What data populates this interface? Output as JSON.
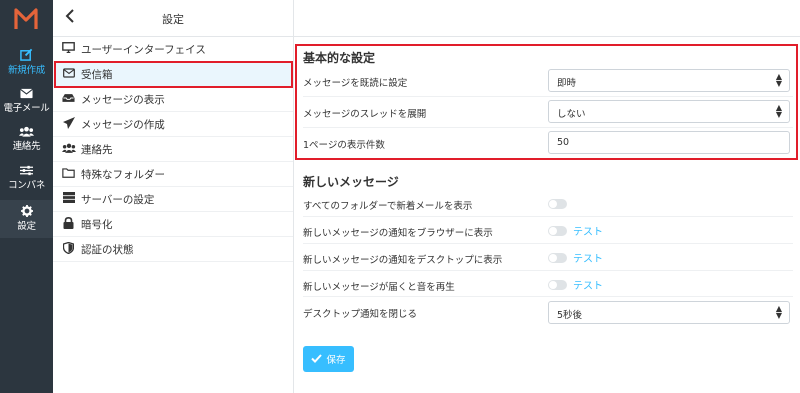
{
  "rail": {
    "compose_label": "新規作成",
    "mail_label": "電子メール",
    "contacts_label": "連絡先",
    "control_panel_label": "コンパネ",
    "settings_label": "設定",
    "accent_color": "#37beff",
    "bg_color": "#2c363f"
  },
  "list": {
    "title": "設定",
    "items": [
      {
        "label": "ユーザーインターフェイス",
        "icon": "monitor-icon"
      },
      {
        "label": "受信箱",
        "icon": "envelope-icon"
      },
      {
        "label": "メッセージの表示",
        "icon": "inbox-tray-icon"
      },
      {
        "label": "メッセージの作成",
        "icon": "paper-plane-icon"
      },
      {
        "label": "連絡先",
        "icon": "users-icon"
      },
      {
        "label": "特殊なフォルダー",
        "icon": "folder-icon"
      },
      {
        "label": "サーバーの設定",
        "icon": "server-icon"
      },
      {
        "label": "暗号化",
        "icon": "lock-icon"
      },
      {
        "label": "認証の状態",
        "icon": "shield-icon"
      }
    ]
  },
  "main": {
    "basic_heading": "基本的な設定",
    "mark_read_label": "メッセージを既読に設定",
    "mark_read_value": "即時",
    "expand_threads_label": "メッセージのスレッドを展開",
    "expand_threads_value": "しない",
    "per_page_label": "1ページの表示件数",
    "per_page_value": "50",
    "new_heading": "新しいメッセージ",
    "new_in_all_folders_label": "すべてのフォルダーで新着メールを表示",
    "browser_notify_label": "新しいメッセージの通知をブラウザーに表示",
    "desktop_notify_label": "新しいメッセージの通知をデスクトップに表示",
    "sound_label": "新しいメッセージが届くと音を再生",
    "close_desktop_label": "デスクトップ通知を閉じる",
    "close_desktop_value": "5秒後",
    "test_label": "テスト",
    "save_label": "保存"
  }
}
